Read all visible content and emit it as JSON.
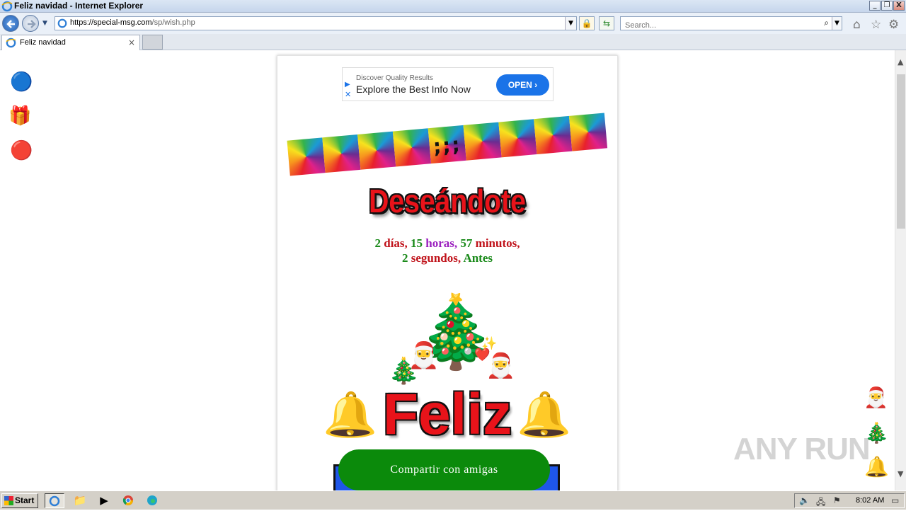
{
  "window": {
    "title": "Feliz navidad - Internet Explorer",
    "minimize": "_",
    "restore": "❐",
    "close": "X"
  },
  "address_bar": {
    "url_main": "https://special-msg.com",
    "url_path": "/sp/wish.php"
  },
  "search": {
    "placeholder": "Search..."
  },
  "tab": {
    "label": "Feliz navidad",
    "close": "×"
  },
  "ad": {
    "line1": "Discover Quality Results",
    "line2": "Explore the Best Info Now",
    "button": "OPEN ›"
  },
  "banner": {
    "symbol": ";;;"
  },
  "heading": "Deseándote",
  "countdown": {
    "days_num": "2",
    "days_label": "días,",
    "hours_num": "15",
    "hours_label": "horas,",
    "minutes_num": "57",
    "minutes_label": "minutos,",
    "seconds_num": "2",
    "seconds_label": "segundos,",
    "suffix": "Antes"
  },
  "feliz": "Feliz",
  "share_button": "Compartir con amigas",
  "watermark": "ANY RUN",
  "taskbar": {
    "start": "Start",
    "clock": "8:02 AM"
  },
  "colors": {
    "accent_green": "#0b8a0b",
    "accent_red": "#e8131a",
    "ad_blue": "#1a73e8"
  }
}
